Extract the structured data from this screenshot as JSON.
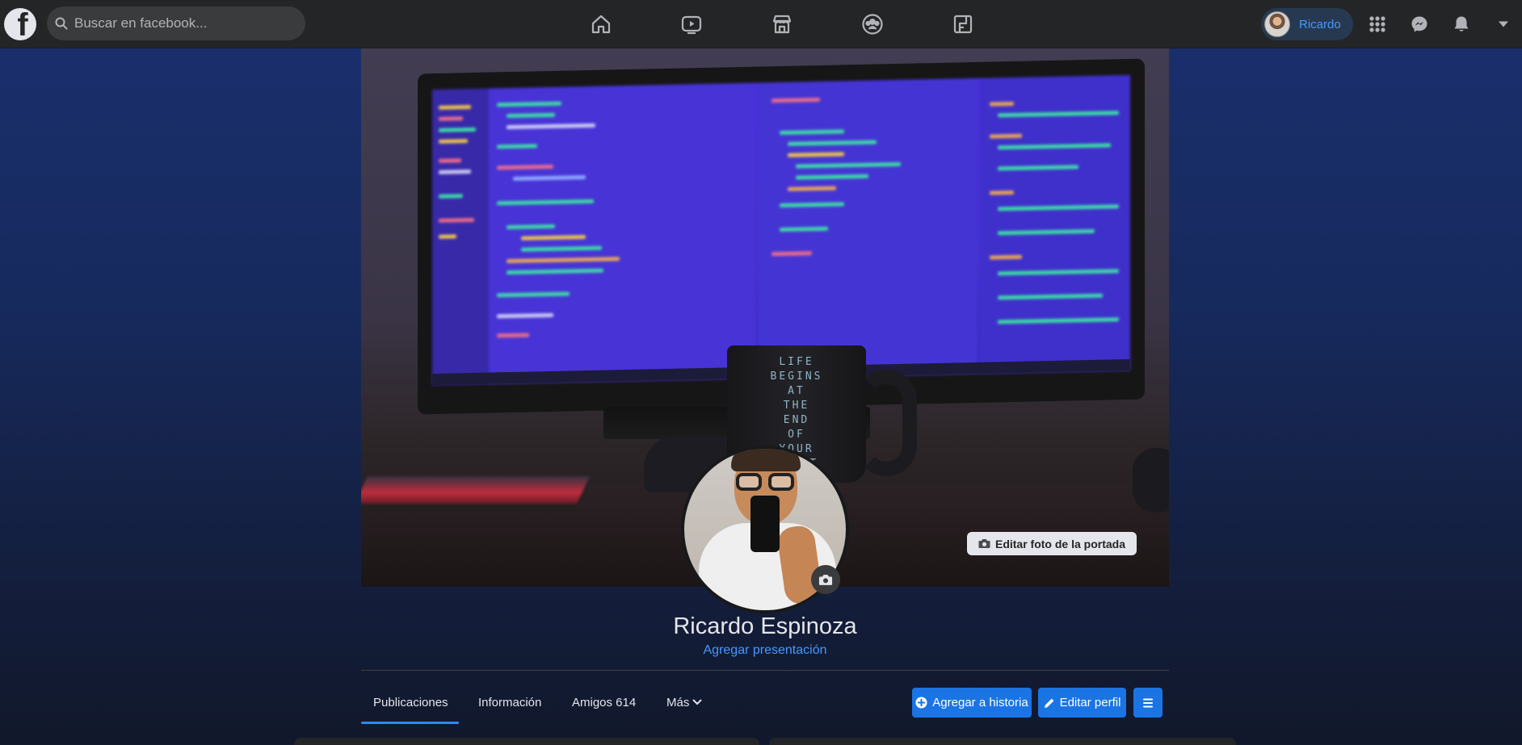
{
  "topbar": {
    "logo": "f",
    "search_placeholder": "Buscar en facebook...",
    "nav_icons": [
      "home-icon",
      "watch-icon",
      "marketplace-icon",
      "groups-icon",
      "gaming-icon"
    ],
    "user_name": "Ricardo",
    "right_icons": [
      "menu-grid-icon",
      "messenger-icon",
      "notifications-icon",
      "account-caret-icon"
    ]
  },
  "cover": {
    "mug_lines": [
      "LIFE",
      "BEGINS",
      "AT",
      "THE",
      "END",
      "OF",
      "YOUR",
      "...RT"
    ],
    "edit_cover_label": "Editar foto de la portada"
  },
  "profile": {
    "name": "Ricardo Espinoza",
    "add_bio": "Agregar presentación"
  },
  "tabs": [
    {
      "label": "Publicaciones",
      "active": true
    },
    {
      "label": "Información"
    },
    {
      "label": "Amigos 614"
    },
    {
      "label": "Más"
    }
  ],
  "actions": {
    "add_story": "Agregar a historia",
    "edit_profile": "Editar perfil"
  },
  "colors": {
    "accent": "#1b74e4",
    "link": "#4599ff",
    "topbar": "#242526"
  }
}
